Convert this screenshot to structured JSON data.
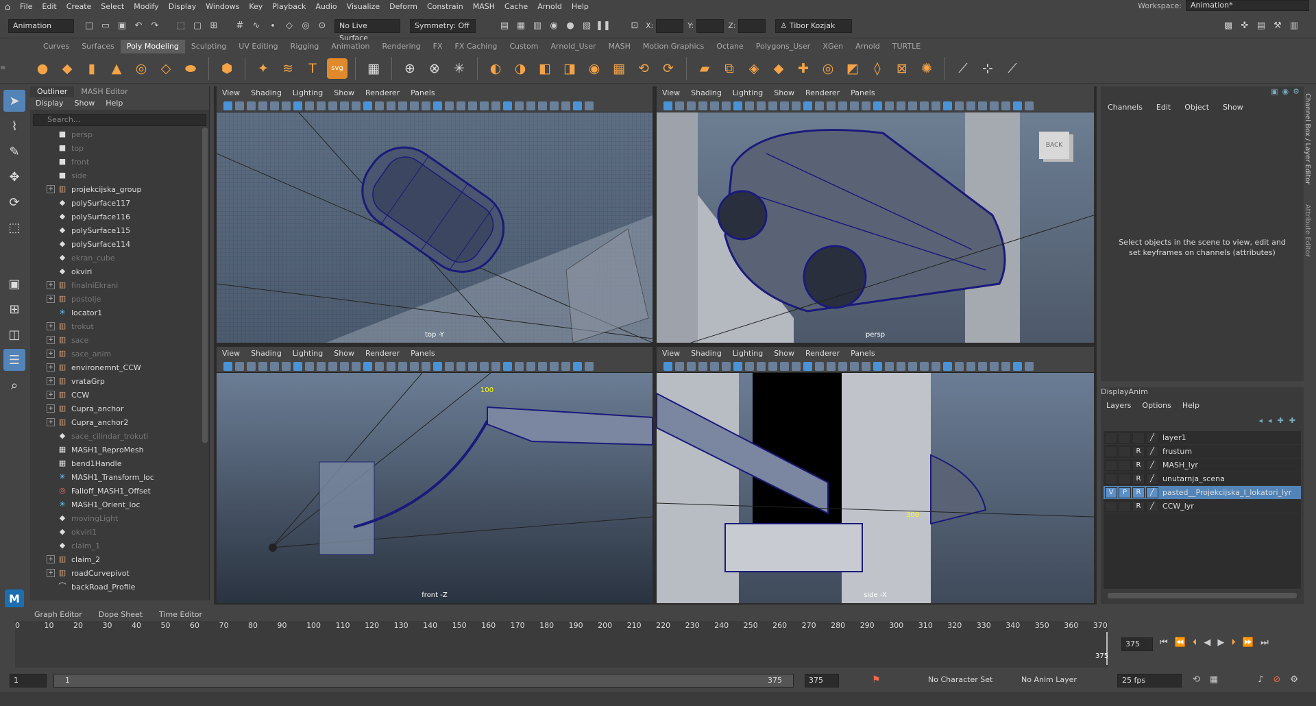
{
  "menubar": {
    "items": [
      "File",
      "Edit",
      "Create",
      "Select",
      "Modify",
      "Display",
      "Windows",
      "Key",
      "Playback",
      "Audio",
      "Visualize",
      "Deform",
      "Constrain",
      "MASH",
      "Cache",
      "Arnold",
      "Help"
    ],
    "workspace_label": "Workspace:",
    "workspace_value": "Animation*"
  },
  "status": {
    "mode": "Animation",
    "live_surface": "No Live Surface",
    "symmetry": "Symmetry: Off",
    "x_label": "X:",
    "y_label": "Y:",
    "z_label": "Z:",
    "user": "Tibor Kozjak"
  },
  "shelf": {
    "tabs": [
      "Curves",
      "Surfaces",
      "Poly Modeling",
      "Sculpting",
      "UV Editing",
      "Rigging",
      "Animation",
      "Rendering",
      "FX",
      "FX Caching",
      "Custom",
      "Arnold_User",
      "MASH",
      "Motion Graphics",
      "Octane",
      "Polygons_User",
      "XGen",
      "Arnold",
      "TURTLE"
    ],
    "active_tab": "Poly Modeling"
  },
  "outliner": {
    "tabs": [
      "Outliner",
      "MASH Editor"
    ],
    "menu": [
      "Display",
      "Show",
      "Help"
    ],
    "search_placeholder": "Search...",
    "items": [
      {
        "label": "persp",
        "dim": true,
        "expand": false,
        "icon": "camera-icon"
      },
      {
        "label": "top",
        "dim": true,
        "expand": false,
        "icon": "camera-icon"
      },
      {
        "label": "front",
        "dim": true,
        "expand": false,
        "icon": "camera-icon"
      },
      {
        "label": "side",
        "dim": true,
        "expand": false,
        "icon": "camera-icon"
      },
      {
        "label": "projekcijska_group",
        "dim": false,
        "expand": true,
        "icon": "group-icon"
      },
      {
        "label": "polySurface117",
        "dim": false,
        "expand": false,
        "icon": "mesh-icon"
      },
      {
        "label": "polySurface116",
        "dim": false,
        "expand": false,
        "icon": "mesh-icon"
      },
      {
        "label": "polySurface115",
        "dim": false,
        "expand": false,
        "icon": "mesh-icon"
      },
      {
        "label": "polySurface114",
        "dim": false,
        "expand": false,
        "icon": "mesh-icon"
      },
      {
        "label": "ekran_cube",
        "dim": true,
        "expand": false,
        "icon": "mesh-icon"
      },
      {
        "label": "okviri",
        "dim": false,
        "expand": false,
        "icon": "mesh-icon"
      },
      {
        "label": "finalniEkrani",
        "dim": true,
        "expand": true,
        "icon": "group-icon"
      },
      {
        "label": "postolje",
        "dim": true,
        "expand": true,
        "icon": "group-icon"
      },
      {
        "label": "locator1",
        "dim": false,
        "expand": false,
        "icon": "locator-icon"
      },
      {
        "label": "trokut",
        "dim": true,
        "expand": true,
        "icon": "group-icon"
      },
      {
        "label": "sace",
        "dim": true,
        "expand": true,
        "icon": "group-icon"
      },
      {
        "label": "sace_anim",
        "dim": true,
        "expand": true,
        "icon": "group-icon"
      },
      {
        "label": "environemnt_CCW",
        "dim": false,
        "expand": true,
        "icon": "group-icon"
      },
      {
        "label": "vrataGrp",
        "dim": false,
        "expand": true,
        "icon": "group-icon"
      },
      {
        "label": "CCW",
        "dim": false,
        "expand": true,
        "icon": "group-icon"
      },
      {
        "label": "Cupra_anchor",
        "dim": false,
        "expand": true,
        "icon": "group-icon"
      },
      {
        "label": "Cupra_anchor2",
        "dim": false,
        "expand": true,
        "icon": "group-icon"
      },
      {
        "label": "sace_cilindar_trokuti",
        "dim": true,
        "expand": false,
        "icon": "mesh-icon"
      },
      {
        "label": "MASH1_ReproMesh",
        "dim": false,
        "expand": false,
        "icon": "mash-icon"
      },
      {
        "label": "bend1Handle",
        "dim": false,
        "expand": false,
        "icon": "handle-icon"
      },
      {
        "label": "MASH1_Transform_loc",
        "dim": false,
        "expand": false,
        "icon": "locator-icon"
      },
      {
        "label": "Falloff_MASH1_Offset",
        "dim": false,
        "expand": false,
        "icon": "falloff-icon"
      },
      {
        "label": "MASH1_Orient_loc",
        "dim": false,
        "expand": false,
        "icon": "locator-icon"
      },
      {
        "label": "movingLight",
        "dim": true,
        "expand": false,
        "icon": "mesh-icon"
      },
      {
        "label": "okviri1",
        "dim": true,
        "expand": false,
        "icon": "mesh-icon"
      },
      {
        "label": "claim_1",
        "dim": true,
        "expand": false,
        "icon": "mesh-icon"
      },
      {
        "label": "claim_2",
        "dim": false,
        "expand": true,
        "icon": "group-icon"
      },
      {
        "label": "roadCurvepivot",
        "dim": false,
        "expand": true,
        "icon": "group-icon"
      },
      {
        "label": "backRoad_Profile",
        "dim": false,
        "expand": false,
        "icon": "curve-icon"
      }
    ]
  },
  "viewport": {
    "menu": [
      "View",
      "Shading",
      "Lighting",
      "Show",
      "Renderer",
      "Panels"
    ],
    "panes": [
      {
        "camera": "top -Y"
      },
      {
        "camera": "persp",
        "viewcube": "BACK"
      },
      {
        "camera": "front -Z",
        "annotation": "100"
      },
      {
        "camera": "side -X",
        "annotation": "300"
      }
    ]
  },
  "channel_box": {
    "menu": [
      "Channels",
      "Edit",
      "Object",
      "Show"
    ],
    "hint": "Select objects in the scene to view, edit and set keyframes on channels (attributes)"
  },
  "layer_editor": {
    "tabs": [
      "Display",
      "Anim"
    ],
    "menu": [
      "Layers",
      "Options",
      "Help"
    ],
    "layers": [
      {
        "name": "layer1",
        "v": "",
        "p": "",
        "r": "",
        "selected": false
      },
      {
        "name": "frustum",
        "v": "",
        "p": "",
        "r": "R",
        "selected": false
      },
      {
        "name": "MASH_lyr",
        "v": "",
        "p": "",
        "r": "R",
        "selected": false
      },
      {
        "name": "unutarnja_scena",
        "v": "",
        "p": "",
        "r": "R",
        "selected": false
      },
      {
        "name": "pasted__Projekcijska_I_lokatori_lyr",
        "v": "V",
        "p": "P",
        "r": "R",
        "selected": true
      },
      {
        "name": "CCW_lyr",
        "v": "",
        "p": "",
        "r": "R",
        "selected": false
      }
    ]
  },
  "side_tabs": [
    "Channel Box / Layer Editor",
    "Attribute Editor"
  ],
  "time_tabs": [
    "Graph Editor",
    "Dope Sheet",
    "Time Editor"
  ],
  "timeline": {
    "ticks": [
      0,
      10,
      20,
      30,
      40,
      50,
      60,
      70,
      80,
      90,
      100,
      110,
      120,
      130,
      140,
      150,
      160,
      170,
      180,
      190,
      200,
      210,
      220,
      230,
      240,
      250,
      260,
      270,
      280,
      290,
      300,
      310,
      320,
      330,
      340,
      350,
      360,
      370
    ],
    "max": 375,
    "current_frame": "375",
    "end_marker": "375"
  },
  "range": {
    "start": "1",
    "inner_start": "1",
    "inner_end": "375",
    "end": "375",
    "character_set": "No Character Set",
    "anim_layer": "No Anim Layer",
    "fps": "25 fps"
  },
  "colors": {
    "accent": "#5284b8",
    "viewport_bg_top": "#6b7d95",
    "viewport_bg_bottom": "#2a3340",
    "wire": "#1a1a7a"
  }
}
